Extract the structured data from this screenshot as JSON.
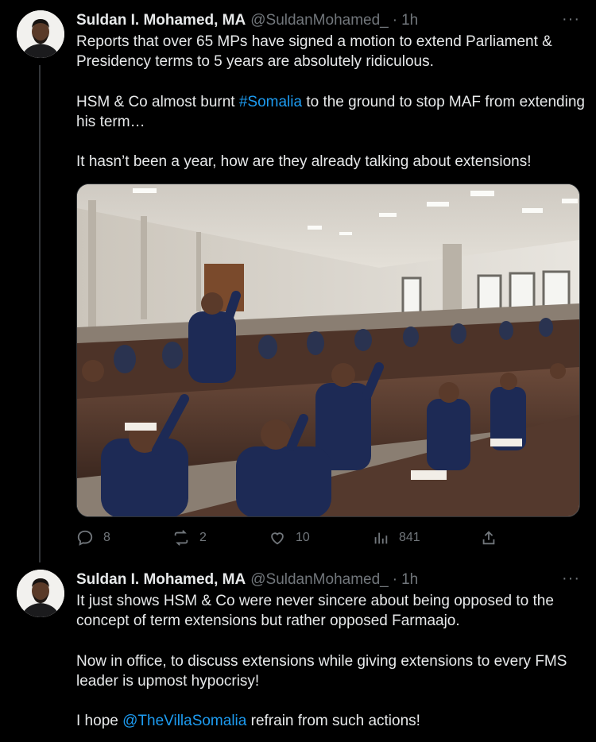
{
  "tweets": [
    {
      "author_name": "Suldan I. Mohamed, MA",
      "handle": "@SuldanMohamed_",
      "separator": "·",
      "time": "1h",
      "more_icon": "···",
      "para1": "Reports that over 65 MPs have signed a motion to extend Parliament & Presidency terms to 5 years are absolutely ridiculous.",
      "para2_pre": "HSM & Co almost burnt ",
      "para2_link": "#Somalia",
      "para2_post": " to the ground to stop MAF from extending his term…",
      "para3": "It hasn’t been a year, how are they already talking about extensions!",
      "actions": {
        "replies": "8",
        "reposts": "2",
        "likes": "10",
        "views": "841"
      }
    },
    {
      "author_name": "Suldan I. Mohamed, MA",
      "handle": "@SuldanMohamed_",
      "separator": "·",
      "time": "1h",
      "more_icon": "···",
      "para1": "It just shows HSM & Co were never sincere about being opposed to the concept of term extensions but rather opposed Farmaajo.",
      "para2": "Now in office, to discuss extensions while giving extensions to every FMS leader is upmost hypocrisy!",
      "para3_pre": "I hope ",
      "para3_link": "@TheVillaSomalia",
      "para3_post": " refrain from such actions!"
    }
  ],
  "colors": {
    "background": "#000000",
    "text": "#e7e9ea",
    "muted": "#71767b",
    "link": "#1d9bf0"
  }
}
